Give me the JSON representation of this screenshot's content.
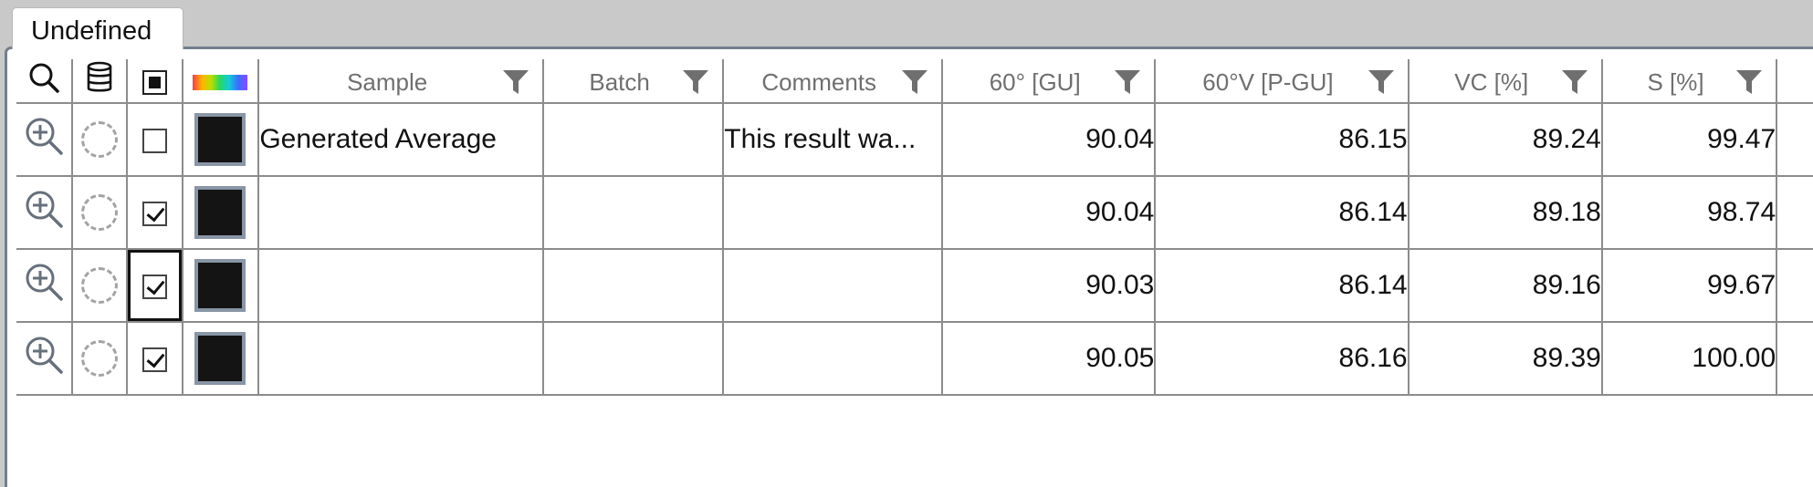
{
  "tab": {
    "label": "Undefined"
  },
  "columns": [
    {
      "key": "zoom",
      "icon": "search-icon"
    },
    {
      "key": "source",
      "icon": "database-icon"
    },
    {
      "key": "select",
      "icon": "select-all-checkbox"
    },
    {
      "key": "color",
      "icon": "color-spectrum-icon"
    },
    {
      "key": "sample",
      "label": "Sample",
      "filter": true
    },
    {
      "key": "batch",
      "label": "Batch",
      "filter": true
    },
    {
      "key": "comments",
      "label": "Comments",
      "filter": true
    },
    {
      "key": "gu60",
      "label": "60° [GU]",
      "filter": true
    },
    {
      "key": "pgu60v",
      "label": "60°V [P-GU]",
      "filter": true
    },
    {
      "key": "vc",
      "label": "VC [%]",
      "filter": true
    },
    {
      "key": "s",
      "label": "S [%]",
      "filter": true
    }
  ],
  "rows": [
    {
      "checked": false,
      "swatch_color": "#141414",
      "sample": "Generated Average",
      "batch": "",
      "comments": "This result wa...",
      "gu60": "90.04",
      "pgu60v": "86.15",
      "vc": "89.24",
      "s": "99.47"
    },
    {
      "checked": true,
      "swatch_color": "#141414",
      "sample": "",
      "batch": "",
      "comments": "",
      "gu60": "90.04",
      "pgu60v": "86.14",
      "vc": "89.18",
      "s": "98.74"
    },
    {
      "checked": true,
      "focused": true,
      "swatch_color": "#141414",
      "sample": "",
      "batch": "",
      "comments": "",
      "gu60": "90.03",
      "pgu60v": "86.14",
      "vc": "89.16",
      "s": "99.67"
    },
    {
      "checked": true,
      "swatch_color": "#141414",
      "sample": "",
      "batch": "",
      "comments": "",
      "gu60": "90.05",
      "pgu60v": "86.16",
      "vc": "89.39",
      "s": "100.00"
    }
  ]
}
